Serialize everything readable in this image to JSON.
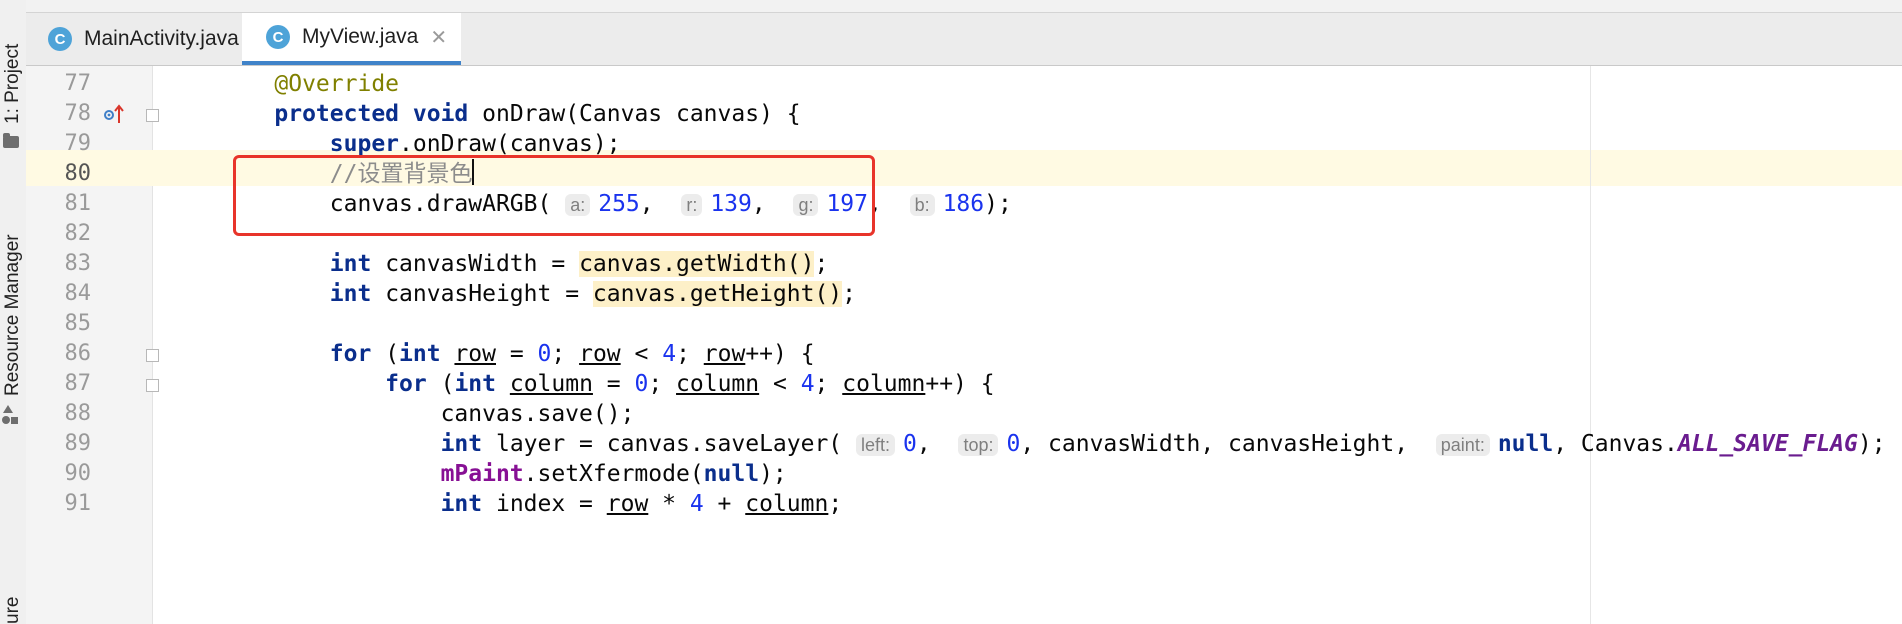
{
  "tool_window": {
    "project_label": "1: Project",
    "resource_manager_label": "Resource Manager",
    "structure_label": "ure"
  },
  "tabs": [
    {
      "label": "MainActivity.java",
      "icon": "C",
      "active": false
    },
    {
      "label": "MyView.java",
      "icon": "C",
      "active": true
    }
  ],
  "editor": {
    "lines": [
      {
        "number": "77"
      },
      {
        "number": "78"
      },
      {
        "number": "79"
      },
      {
        "number": "80"
      },
      {
        "number": "81"
      },
      {
        "number": "82"
      },
      {
        "number": "83"
      },
      {
        "number": "84"
      },
      {
        "number": "85"
      },
      {
        "number": "86"
      },
      {
        "number": "87"
      },
      {
        "number": "88"
      },
      {
        "number": "89"
      },
      {
        "number": "90"
      },
      {
        "number": "91"
      }
    ],
    "current_line": "80",
    "tokens": {
      "override": "@Override",
      "protected": "protected",
      "void": "void",
      "ondraw_sig": "onDraw(Canvas canvas) {",
      "super": "super",
      "super_call": ".onDraw(canvas);",
      "comment": "//设置背景色",
      "drawargb": "canvas.drawARGB(",
      "hint_a": "a:",
      "val_a": "255",
      "hint_r": "r:",
      "val_r": "139",
      "hint_g": "g:",
      "val_g": "197",
      "hint_b": "b:",
      "val_b": "186",
      "close_stmt": ");",
      "int": "int",
      "canvas_width_decl": "canvasWidth = ",
      "get_width": "canvas.getWidth()",
      "canvas_height_decl": "canvasHeight = ",
      "get_height": "canvas.getHeight()",
      "semicolon": ";",
      "for": "for",
      "open_paren": "(",
      "row": "row",
      "column": "column",
      "eq": " = ",
      "zero": "0",
      "lt": " < ",
      "four": "4",
      "sep": "; ",
      "incr_close": "++) {",
      "save": "canvas.save();",
      "layer_decl": "layer = canvas.saveLayer(",
      "hint_left": "left:",
      "hint_top": "top:",
      "size_args": "canvasWidth, canvasHeight, ",
      "hint_paint": "paint:",
      "null": "null",
      "canvas_dot": ", Canvas.",
      "all_save_flag": "ALL_SAVE_FLAG",
      "mpaint": "mPaint",
      "set_xfermode": ".setXfermode(",
      "index_decl": "index = ",
      "times": " * ",
      "plus": " + ",
      "comma": ", "
    }
  },
  "colors": {
    "keyword": "#0a2e8c",
    "annotation": "#808000",
    "number": "#1a33ee",
    "comment": "#8c8c8c",
    "highlight_box": "#e8342a",
    "active_tab_underline": "#4083c9"
  }
}
